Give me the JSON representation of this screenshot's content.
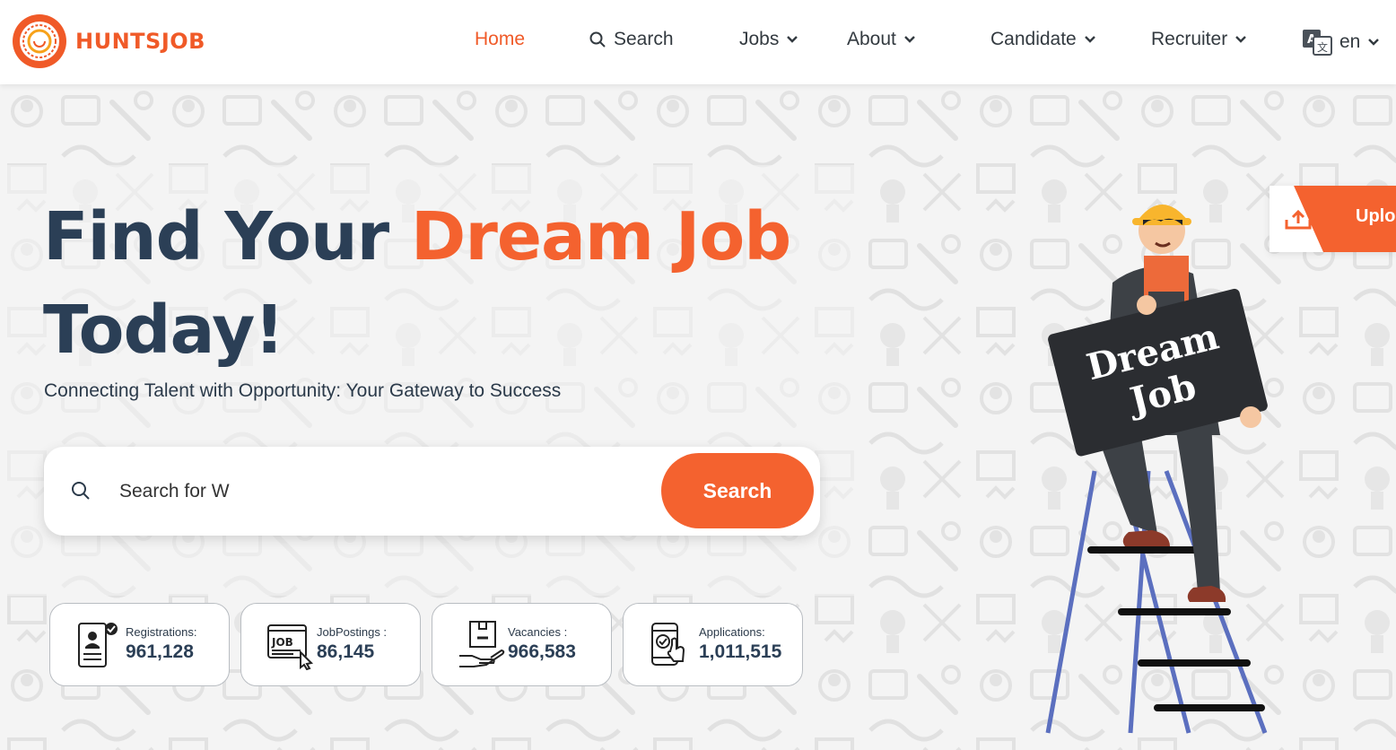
{
  "brand": {
    "name": "HUNTSJOB"
  },
  "nav": {
    "home": "Home",
    "search": "Search",
    "jobs": "Jobs",
    "about": "About",
    "candidate": "Candidate",
    "recruiter": "Recruiter",
    "language": "en"
  },
  "hero": {
    "title_part1": "Find Your ",
    "title_accent": "Dream Job",
    "title_part2": "Today!",
    "subtitle": "Connecting Talent with Opportunity: Your Gateway to Success"
  },
  "search": {
    "value": "Search for W",
    "button_label": "Search"
  },
  "stats": [
    {
      "label": "Registrations:",
      "value": "961,128",
      "icon": "registration-icon"
    },
    {
      "label": "JobPostings :",
      "value": "86,145",
      "icon": "job-posting-icon"
    },
    {
      "label": "Vacancies :",
      "value": "966,583",
      "icon": "vacancy-icon"
    },
    {
      "label": "Applications:",
      "value": "1,011,515",
      "icon": "application-icon"
    }
  ],
  "upload": {
    "label": "Uplo"
  },
  "illustration": {
    "sign_line1": "Dream",
    "sign_line2": "Job"
  },
  "colors": {
    "accent": "#f4622f",
    "heading": "#2b3f56"
  }
}
